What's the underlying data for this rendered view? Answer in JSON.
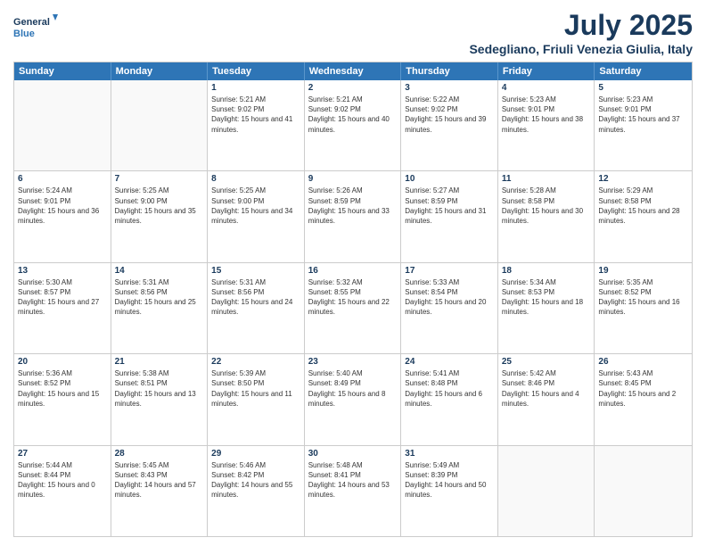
{
  "logo": {
    "line1": "General",
    "line2": "Blue"
  },
  "title": "July 2025",
  "subtitle": "Sedegliano, Friuli Venezia Giulia, Italy",
  "headers": [
    "Sunday",
    "Monday",
    "Tuesday",
    "Wednesday",
    "Thursday",
    "Friday",
    "Saturday"
  ],
  "weeks": [
    [
      {
        "day": "",
        "info": ""
      },
      {
        "day": "",
        "info": ""
      },
      {
        "day": "1",
        "info": "Sunrise: 5:21 AM\nSunset: 9:02 PM\nDaylight: 15 hours and 41 minutes."
      },
      {
        "day": "2",
        "info": "Sunrise: 5:21 AM\nSunset: 9:02 PM\nDaylight: 15 hours and 40 minutes."
      },
      {
        "day": "3",
        "info": "Sunrise: 5:22 AM\nSunset: 9:02 PM\nDaylight: 15 hours and 39 minutes."
      },
      {
        "day": "4",
        "info": "Sunrise: 5:23 AM\nSunset: 9:01 PM\nDaylight: 15 hours and 38 minutes."
      },
      {
        "day": "5",
        "info": "Sunrise: 5:23 AM\nSunset: 9:01 PM\nDaylight: 15 hours and 37 minutes."
      }
    ],
    [
      {
        "day": "6",
        "info": "Sunrise: 5:24 AM\nSunset: 9:01 PM\nDaylight: 15 hours and 36 minutes."
      },
      {
        "day": "7",
        "info": "Sunrise: 5:25 AM\nSunset: 9:00 PM\nDaylight: 15 hours and 35 minutes."
      },
      {
        "day": "8",
        "info": "Sunrise: 5:25 AM\nSunset: 9:00 PM\nDaylight: 15 hours and 34 minutes."
      },
      {
        "day": "9",
        "info": "Sunrise: 5:26 AM\nSunset: 8:59 PM\nDaylight: 15 hours and 33 minutes."
      },
      {
        "day": "10",
        "info": "Sunrise: 5:27 AM\nSunset: 8:59 PM\nDaylight: 15 hours and 31 minutes."
      },
      {
        "day": "11",
        "info": "Sunrise: 5:28 AM\nSunset: 8:58 PM\nDaylight: 15 hours and 30 minutes."
      },
      {
        "day": "12",
        "info": "Sunrise: 5:29 AM\nSunset: 8:58 PM\nDaylight: 15 hours and 28 minutes."
      }
    ],
    [
      {
        "day": "13",
        "info": "Sunrise: 5:30 AM\nSunset: 8:57 PM\nDaylight: 15 hours and 27 minutes."
      },
      {
        "day": "14",
        "info": "Sunrise: 5:31 AM\nSunset: 8:56 PM\nDaylight: 15 hours and 25 minutes."
      },
      {
        "day": "15",
        "info": "Sunrise: 5:31 AM\nSunset: 8:56 PM\nDaylight: 15 hours and 24 minutes."
      },
      {
        "day": "16",
        "info": "Sunrise: 5:32 AM\nSunset: 8:55 PM\nDaylight: 15 hours and 22 minutes."
      },
      {
        "day": "17",
        "info": "Sunrise: 5:33 AM\nSunset: 8:54 PM\nDaylight: 15 hours and 20 minutes."
      },
      {
        "day": "18",
        "info": "Sunrise: 5:34 AM\nSunset: 8:53 PM\nDaylight: 15 hours and 18 minutes."
      },
      {
        "day": "19",
        "info": "Sunrise: 5:35 AM\nSunset: 8:52 PM\nDaylight: 15 hours and 16 minutes."
      }
    ],
    [
      {
        "day": "20",
        "info": "Sunrise: 5:36 AM\nSunset: 8:52 PM\nDaylight: 15 hours and 15 minutes."
      },
      {
        "day": "21",
        "info": "Sunrise: 5:38 AM\nSunset: 8:51 PM\nDaylight: 15 hours and 13 minutes."
      },
      {
        "day": "22",
        "info": "Sunrise: 5:39 AM\nSunset: 8:50 PM\nDaylight: 15 hours and 11 minutes."
      },
      {
        "day": "23",
        "info": "Sunrise: 5:40 AM\nSunset: 8:49 PM\nDaylight: 15 hours and 8 minutes."
      },
      {
        "day": "24",
        "info": "Sunrise: 5:41 AM\nSunset: 8:48 PM\nDaylight: 15 hours and 6 minutes."
      },
      {
        "day": "25",
        "info": "Sunrise: 5:42 AM\nSunset: 8:46 PM\nDaylight: 15 hours and 4 minutes."
      },
      {
        "day": "26",
        "info": "Sunrise: 5:43 AM\nSunset: 8:45 PM\nDaylight: 15 hours and 2 minutes."
      }
    ],
    [
      {
        "day": "27",
        "info": "Sunrise: 5:44 AM\nSunset: 8:44 PM\nDaylight: 15 hours and 0 minutes."
      },
      {
        "day": "28",
        "info": "Sunrise: 5:45 AM\nSunset: 8:43 PM\nDaylight: 14 hours and 57 minutes."
      },
      {
        "day": "29",
        "info": "Sunrise: 5:46 AM\nSunset: 8:42 PM\nDaylight: 14 hours and 55 minutes."
      },
      {
        "day": "30",
        "info": "Sunrise: 5:48 AM\nSunset: 8:41 PM\nDaylight: 14 hours and 53 minutes."
      },
      {
        "day": "31",
        "info": "Sunrise: 5:49 AM\nSunset: 8:39 PM\nDaylight: 14 hours and 50 minutes."
      },
      {
        "day": "",
        "info": ""
      },
      {
        "day": "",
        "info": ""
      }
    ]
  ]
}
